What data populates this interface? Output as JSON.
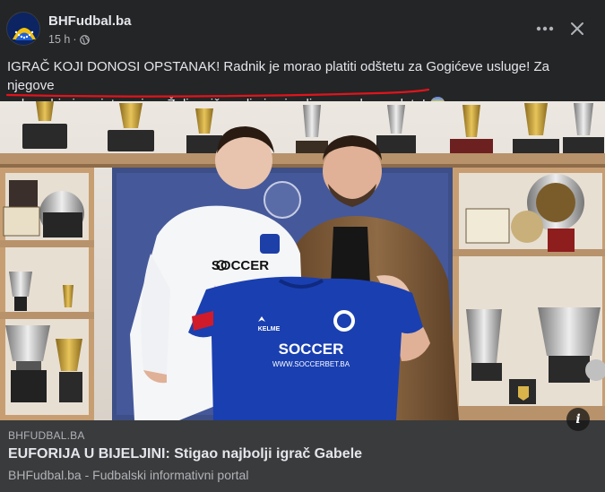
{
  "post": {
    "page_name": "BHFudbal.ba",
    "time": "15 h",
    "dot": "·",
    "privacy_icon": "globe-icon",
    "more_icon": "more-icon",
    "close_icon": "close-icon",
    "caption_line1": "IGRAČ KOJI DONOSI OPSTANAK! Radnik je morao platiti odštetu za Gogićeve usluge! Za njegove",
    "caption_line2": "usluge bio je zainteresiran Željezničar, ali nisu imali novca da ga plate! 😱",
    "underline_color": "#e0141c"
  },
  "photo": {
    "shirt_sponsor": "SOCCER",
    "shirt_sponsor_url": "WWW.SOCCERBET.BA",
    "white_shirt_sponsor": "SOCCER",
    "kit_brand": "KELME"
  },
  "link_preview": {
    "domain": "BHFUDBAL.BA",
    "title": "EUFORIJA U BIJELJINI: Stigao najbolji igrač Gabele",
    "description": "BHFudbal.ba - Fudbalski informativni portal",
    "info_label": "i"
  },
  "colors": {
    "background": "#242526",
    "link_bg": "#3a3b3c",
    "text": "#e4e6eb",
    "muted": "#b0b3b8",
    "shirt_blue": "#1a3fb0"
  }
}
